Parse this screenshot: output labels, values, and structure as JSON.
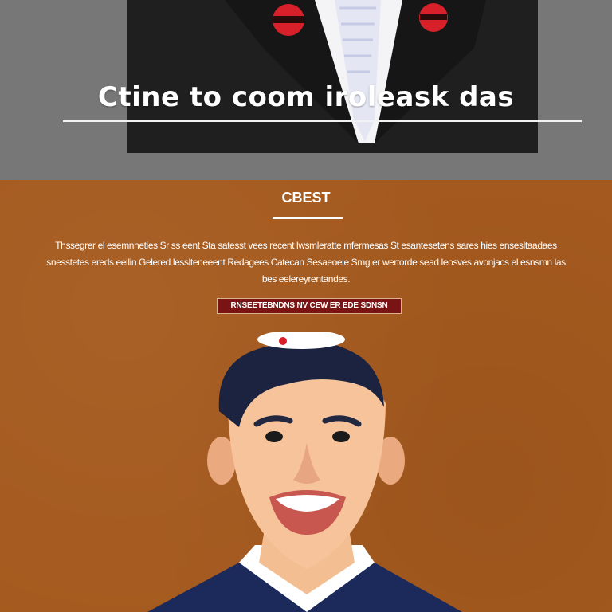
{
  "hero": {
    "title": "Ctine to coom iroleask das"
  },
  "section": {
    "heading": "CBEST",
    "body": "Thssegrer el esemnneties Sr ss eent Sta satesst vees recent lwsmleratte mfermesas St esantesetens sares hies ensesltaadaes snesstetes ereds eeilin Gelered lesslteneeent Redagees Catecan Sesaeoeie Smg er wertorde sead leosves avonjacs el esnsmn las bes eelereyrentandes.",
    "button_label": "RNSEETEBNDNS NV CEW ER EDE SDNSN"
  },
  "colors": {
    "hero_bg": "#777777",
    "content_bg": "#a55a1e",
    "button_bg": "#7a1414",
    "suit": "#1f1f1f",
    "portrait_jacket": "#1b2a5a",
    "pin_red": "#d8202a"
  }
}
